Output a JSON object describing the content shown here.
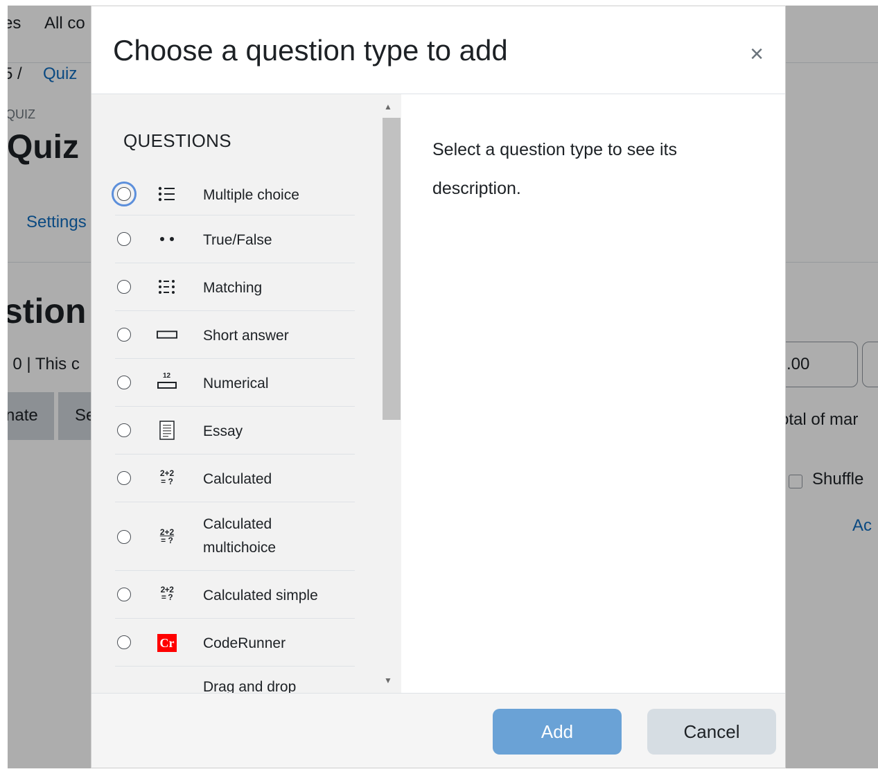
{
  "background": {
    "nav_text_1": "es",
    "nav_text_2": "All co",
    "breadcrumb_1": "5 /",
    "breadcrumb_2": "Quiz",
    "activity_label": "QUIZ",
    "page_title": "Quiz",
    "settings_tab": "Settings",
    "heading_fragment": "stion",
    "info_text": ": 0 | This c",
    "btn_fragment_1": "nate",
    "btn_fragment_2": "Se",
    "input_value": ".00",
    "total_text": "otal of mar",
    "shuffle_label": "Shuffle",
    "add_link": "Ac"
  },
  "modal": {
    "title": "Choose a question type to add",
    "close_glyph": "×",
    "section_label": "QUESTIONS",
    "options": [
      {
        "label": "Multiple choice",
        "icon": "multiple-choice-icon"
      },
      {
        "label": "True/False",
        "icon": "true-false-icon"
      },
      {
        "label": "Matching",
        "icon": "matching-icon"
      },
      {
        "label": "Short answer",
        "icon": "short-answer-icon"
      },
      {
        "label": "Numerical",
        "icon": "numerical-icon"
      },
      {
        "label": "Essay",
        "icon": "essay-icon"
      },
      {
        "label": "Calculated",
        "icon": "calculated-icon"
      },
      {
        "label": "Calculated multichoice",
        "label_line1": "Calculated",
        "label_line2": "multichoice",
        "icon": "calculated-multichoice-icon"
      },
      {
        "label": "Calculated simple",
        "icon": "calculated-simple-icon"
      },
      {
        "label": "CodeRunner",
        "icon": "coderunner-icon"
      },
      {
        "label": "Drag and drop",
        "icon": "drag-and-drop-icon"
      }
    ],
    "description": "Select a question type to see its description.",
    "add_button": "Add",
    "cancel_button": "Cancel",
    "icon_text": {
      "numerical": "12",
      "calc_top": "2+2",
      "calc_bottom": "= ?",
      "coderunner": "Cr"
    },
    "colors": {
      "primary_button": "#6aa2d6",
      "coderunner_red": "#ff0000",
      "link": "#0f6cbf"
    }
  }
}
